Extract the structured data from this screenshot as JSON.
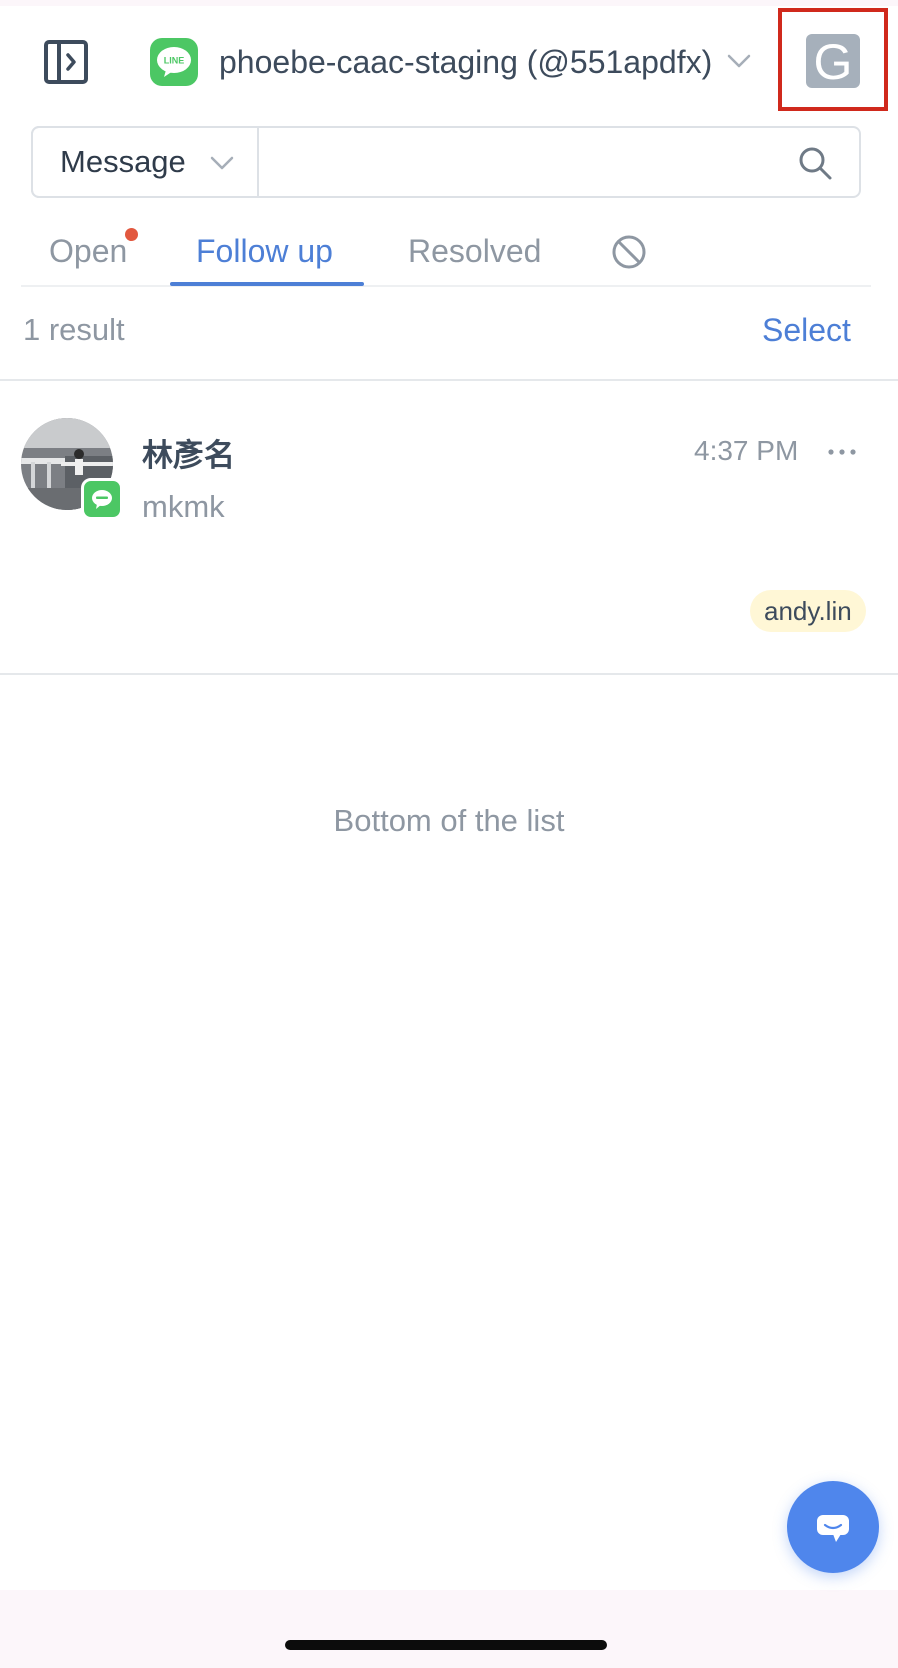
{
  "header": {
    "channel_name": "phoebe-caac-staging (@551apdfx)",
    "channel_icon": "line-app-icon",
    "channel_icon_text": "LINE",
    "account_avatar_letter": "G",
    "highlight_color": "#d0291c"
  },
  "search": {
    "type_label": "Message",
    "query": "",
    "placeholder": ""
  },
  "tabs": [
    {
      "label": "Open",
      "active": false,
      "has_unread_dot": true
    },
    {
      "label": "Follow up",
      "active": true
    },
    {
      "label": "Resolved",
      "active": false
    },
    {
      "label": "",
      "icon": "block-icon",
      "active": false
    }
  ],
  "results": {
    "count_label": "1 result",
    "select_label": "Select"
  },
  "conversations": [
    {
      "name": "林彥名",
      "time": "4:37 PM",
      "preview": "mkmk",
      "tag": "andy.lin",
      "channel_badge": "line-icon"
    }
  ],
  "list_end_label": "Bottom of the list",
  "colors": {
    "accent": "#4d7fd6",
    "line_green": "#4cc764",
    "unread_dot": "#e2583f",
    "tag_bg": "#fff7d6",
    "fab": "#4f86ec"
  }
}
